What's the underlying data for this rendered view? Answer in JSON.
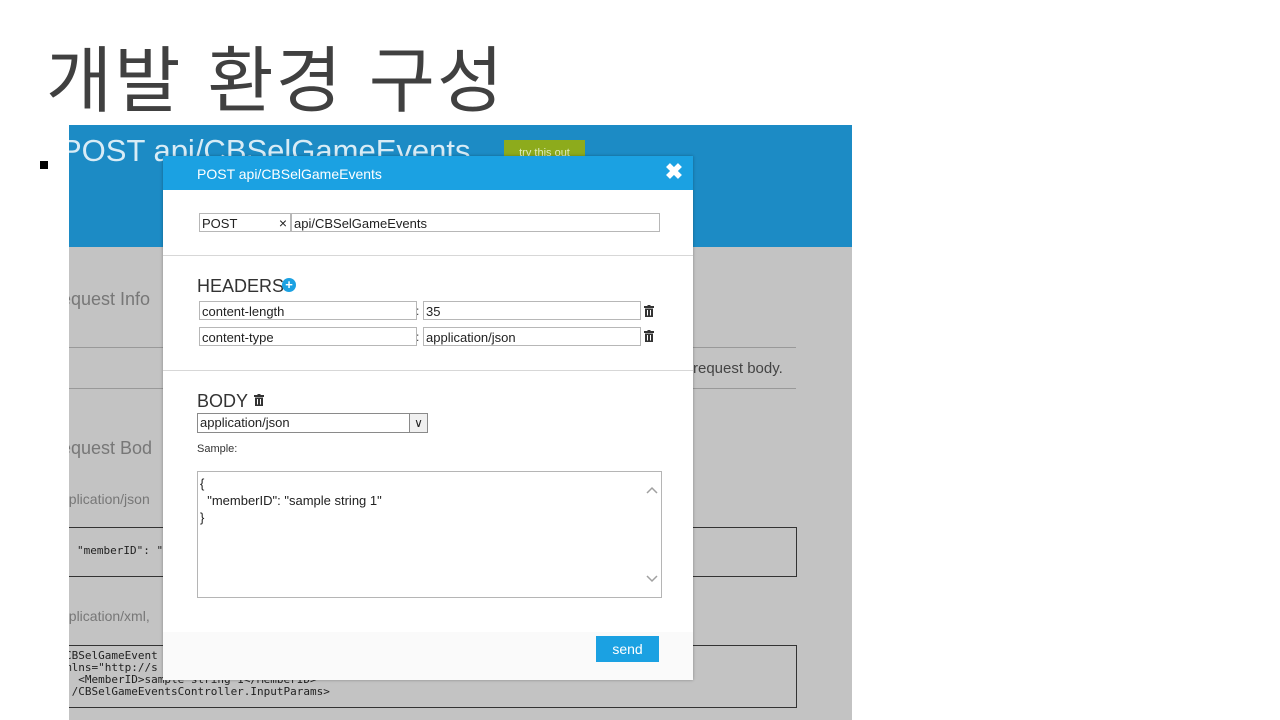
{
  "slide": {
    "title": "개발 환경 구성"
  },
  "background_page": {
    "title": "POST api/CBSelGameEvents",
    "try_button": "try this out",
    "request_info": "equest Info",
    "request_body_note": "request body.",
    "request_body": "equest Bod",
    "json_label": "pplication/json",
    "json_sample": "\"memberID\": \"",
    "xml_label": "pplication/xml,",
    "xml_sample": "CBSelGameEvent\nmlns=\"http://s\n  <MemberID>sample string 1</MemberID>\n:/CBSelGameEventsController.InputParams>"
  },
  "dialog": {
    "title": "POST api/CBSelGameEvents",
    "close_glyph": "✖",
    "method": "POST",
    "method_clear": "×",
    "url": "api/CBSelGameEvents",
    "headers_title": "HEADERS",
    "add_glyph": "+",
    "colon": ":",
    "headers": [
      {
        "name": "content-length",
        "value": "35"
      },
      {
        "name": "content-type",
        "value": "application/json"
      }
    ],
    "body_title": "BODY",
    "content_type_selected": "application/json",
    "select_arrow": "∨",
    "sample_label": "Sample:",
    "sample_body": "{\n  \"memberID\": \"sample string 1\"\n}",
    "send_label": "send"
  },
  "colors": {
    "header_blue": "#1c8bc5",
    "dialog_blue": "#1ba1e2",
    "try_green": "#8dab1c",
    "page_gray": "#c3c3c3"
  }
}
